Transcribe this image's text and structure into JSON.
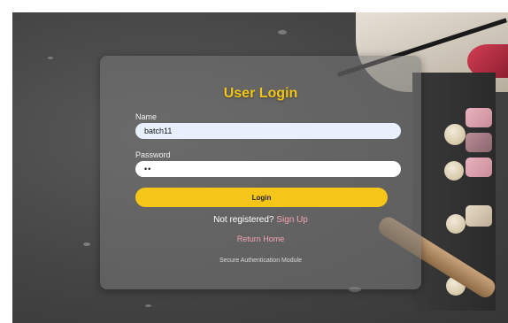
{
  "login": {
    "title": "User Login",
    "name_label": "Name",
    "name_value": "batch11",
    "password_label": "Password",
    "password_value": "••",
    "login_button": "Login",
    "not_registered_text": "Not registered?",
    "sign_up_link": "Sign Up",
    "return_home_link": "Return Home",
    "footer_text": "Secure Authentication Module"
  },
  "colors": {
    "title_yellow": "#f3c613",
    "button_yellow": "#f5c518",
    "link_pink": "#f2a5b4",
    "card_gray": "#787878",
    "input_autofill": "#e8f0fe"
  }
}
